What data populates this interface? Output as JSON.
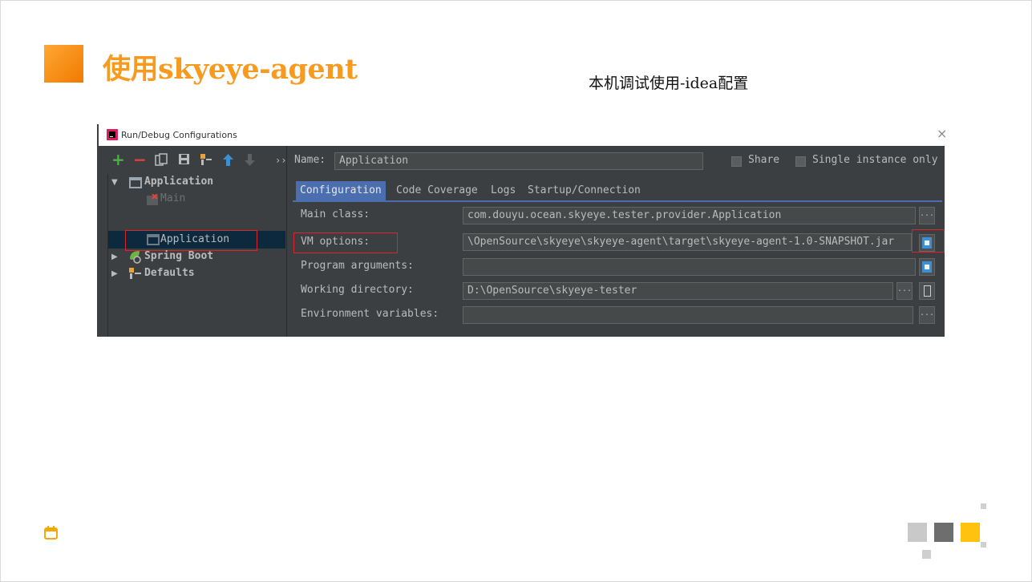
{
  "slide": {
    "title": "使用skyeye-agent",
    "subtitle": "本机调试使用-idea配置"
  },
  "dialog": {
    "title": "Run/Debug Configurations",
    "close_glyph": "×",
    "toolbar": {
      "add": "+",
      "remove": "−",
      "more": "››"
    },
    "tree": {
      "application": "Application",
      "main": "Main",
      "selected": "Application",
      "spring_boot": "Spring Boot",
      "defaults": "Defaults"
    },
    "name_label": "Name:",
    "name_value": "Application",
    "share_label": "Share",
    "single_instance_label": "Single instance only",
    "tabs": [
      "Configuration",
      "Code Coverage",
      "Logs",
      "Startup/Connection"
    ],
    "fields": {
      "main_class_label": "Main class:",
      "main_class_value": "com.douyu.ocean.skyeye.tester.provider.Application",
      "vm_options_label": "VM options:",
      "vm_options_value": "\\OpenSource\\skyeye\\skyeye-agent\\target\\skyeye-agent-1.0-SNAPSHOT.jar",
      "program_args_label": "Program arguments:",
      "program_args_value": "",
      "working_dir_label": "Working directory:",
      "working_dir_value": "D:\\OpenSource\\skyeye-tester",
      "env_vars_label": "Environment variables:",
      "env_vars_value": ""
    },
    "dots": "..."
  },
  "colors": {
    "accent_orange": "#f79a1e",
    "selection_red": "#e0232b",
    "ide_background": "#3c3f41",
    "tab_active": "#4b6eaf"
  }
}
